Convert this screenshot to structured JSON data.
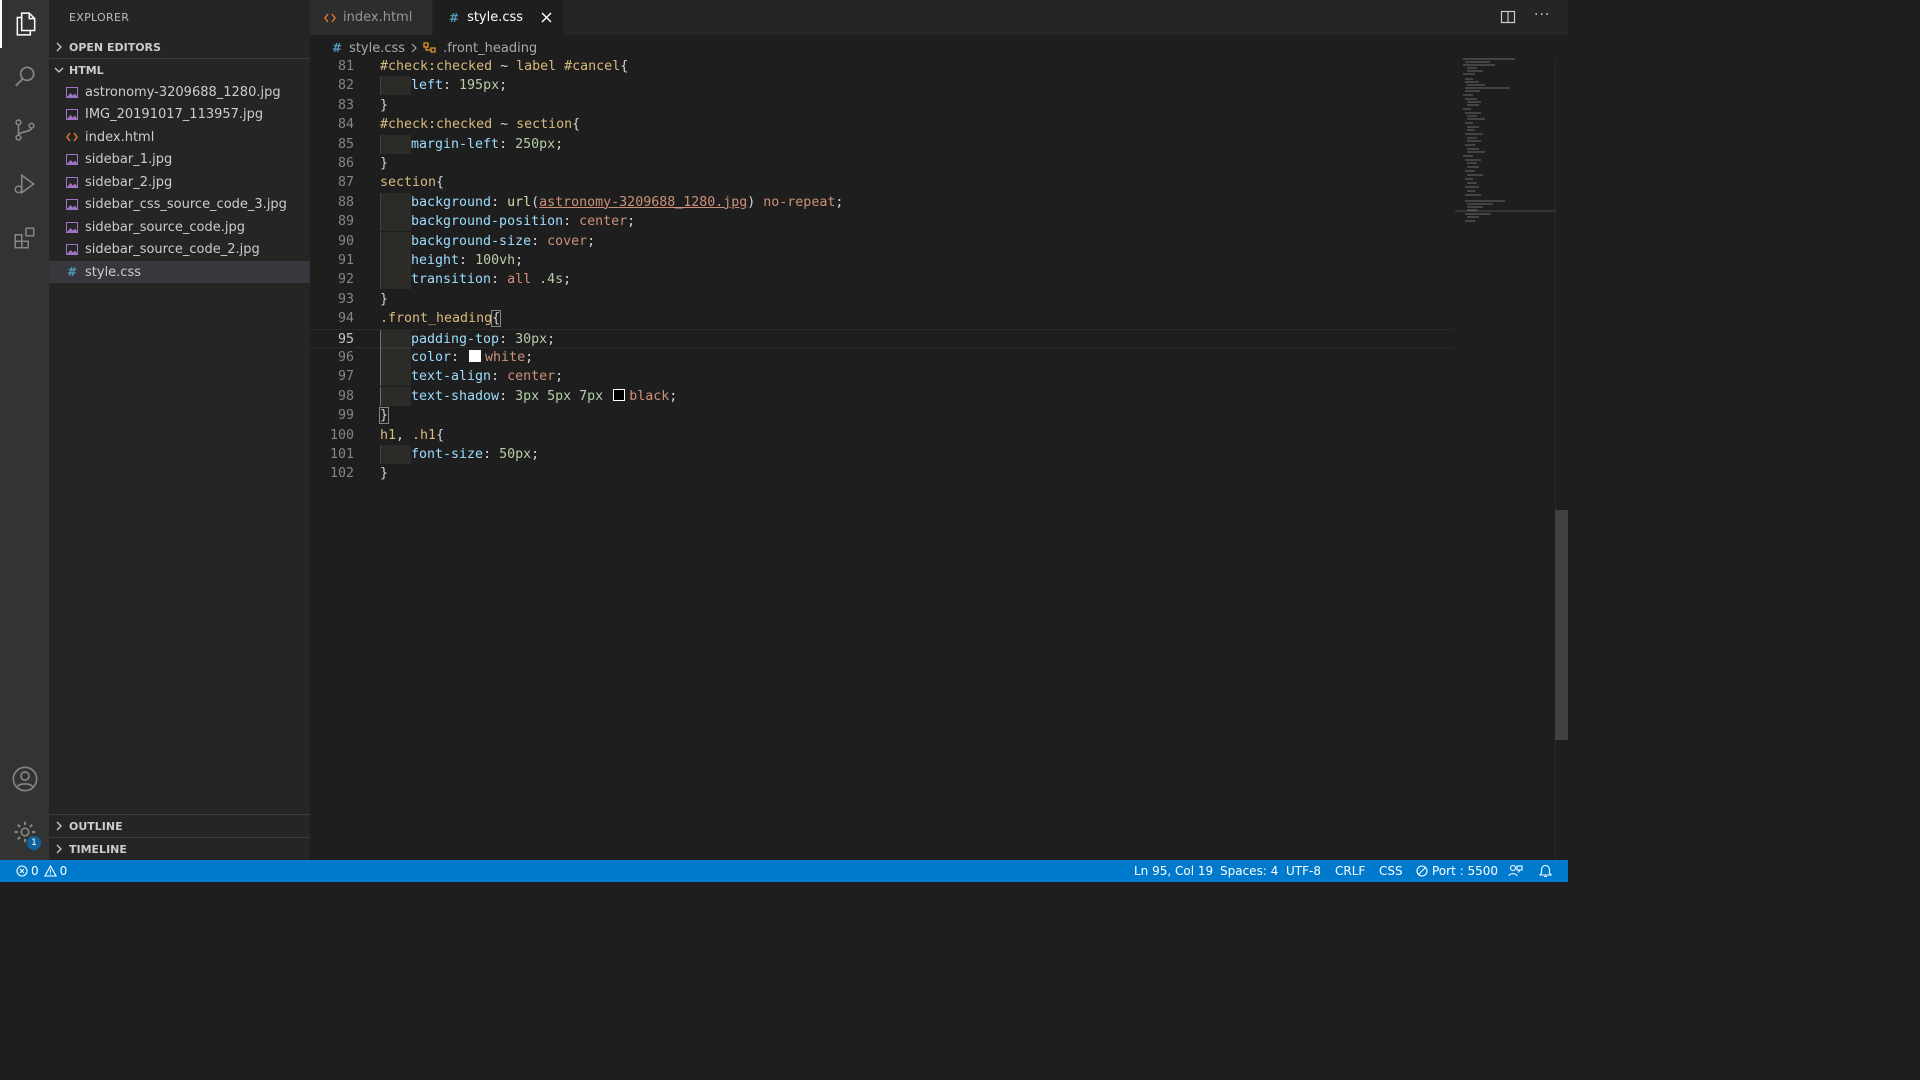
{
  "sidebar": {
    "title": "EXPLORER",
    "open_editors": "OPEN EDITORS",
    "folder": "HTML",
    "files": [
      {
        "name": "astronomy-3209688_1280.jpg",
        "icon": "image-icon"
      },
      {
        "name": "IMG_20191017_113957.jpg",
        "icon": "image-icon"
      },
      {
        "name": "index.html",
        "icon": "html-icon"
      },
      {
        "name": "sidebar_1.jpg",
        "icon": "image-icon"
      },
      {
        "name": "sidebar_2.jpg",
        "icon": "image-icon"
      },
      {
        "name": "sidebar_css_source_code_3.jpg",
        "icon": "image-icon"
      },
      {
        "name": "sidebar_source_code.jpg",
        "icon": "image-icon"
      },
      {
        "name": "sidebar_source_code_2.jpg",
        "icon": "image-icon"
      },
      {
        "name": "style.css",
        "icon": "css-icon",
        "selected": true
      }
    ],
    "outline": "OUTLINE",
    "timeline": "TIMELINE"
  },
  "activity_bar": {
    "items": [
      "explorer-icon",
      "search-icon",
      "source-control-icon",
      "run-debug-icon",
      "extensions-icon"
    ],
    "bottom": [
      "accounts-icon",
      "settings-gear-icon"
    ],
    "settings_badge": "1"
  },
  "tabs": [
    {
      "label": "index.html",
      "active": false
    },
    {
      "label": "style.css",
      "active": true
    }
  ],
  "breadcrumb": {
    "file": "style.css",
    "symbol": ".front_heading"
  },
  "editor": {
    "cursor_line": 95,
    "line_numbers": [
      "81",
      "82",
      "83",
      "84",
      "85",
      "86",
      "87",
      "88",
      "89",
      "90",
      "91",
      "92",
      "93",
      "94",
      "95",
      "96",
      "97",
      "98",
      "99",
      "100",
      "101",
      "102"
    ]
  },
  "status": {
    "errors": "0",
    "warnings": "0",
    "position": "Ln 95, Col 19",
    "spaces": "Spaces: 4",
    "encoding": "UTF-8",
    "eol": "CRLF",
    "language": "CSS",
    "port": "Port : 5500"
  },
  "colors": {
    "accent": "#007acc",
    "image_icon": "#a074c4",
    "html_icon": "#e37933",
    "css_icon": "#519aba"
  }
}
